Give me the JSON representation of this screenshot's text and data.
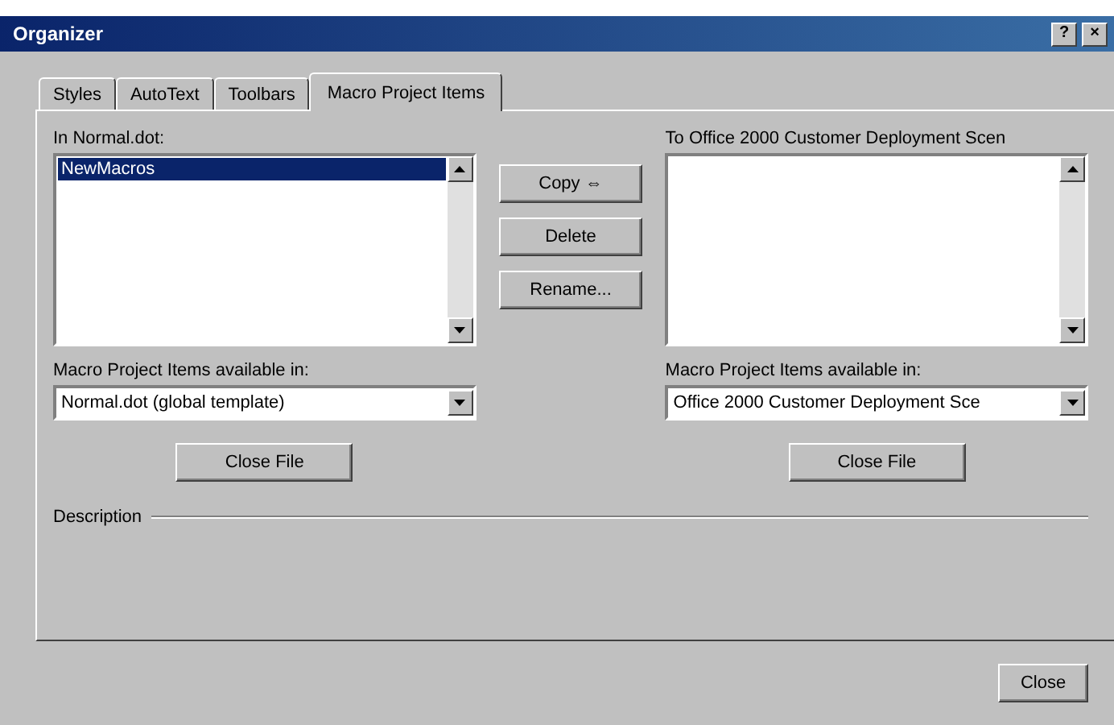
{
  "window": {
    "title": "Organizer",
    "help_button": "?",
    "close_button": "×"
  },
  "tabs": [
    {
      "label": "Styles",
      "selected": false
    },
    {
      "label": "AutoText",
      "selected": false
    },
    {
      "label": "Toolbars",
      "selected": false
    },
    {
      "label": "Macro Project Items",
      "selected": true
    }
  ],
  "left": {
    "list_label": "In Normal.dot:",
    "items": [
      {
        "label": "NewMacros",
        "selected": true
      }
    ],
    "available_label": "Macro Project Items available in:",
    "available_value": "Normal.dot (global template)",
    "close_file": "Close File"
  },
  "right": {
    "list_label": "To Office 2000 Customer Deployment Scen",
    "available_label": "Macro Project Items available in:",
    "available_value": "Office 2000 Customer Deployment Sce",
    "close_file": "Close File"
  },
  "actions": [
    "Copy ⇔",
    "Delete",
    "Rename..."
  ],
  "description_label": "Description",
  "close_button": "Close"
}
